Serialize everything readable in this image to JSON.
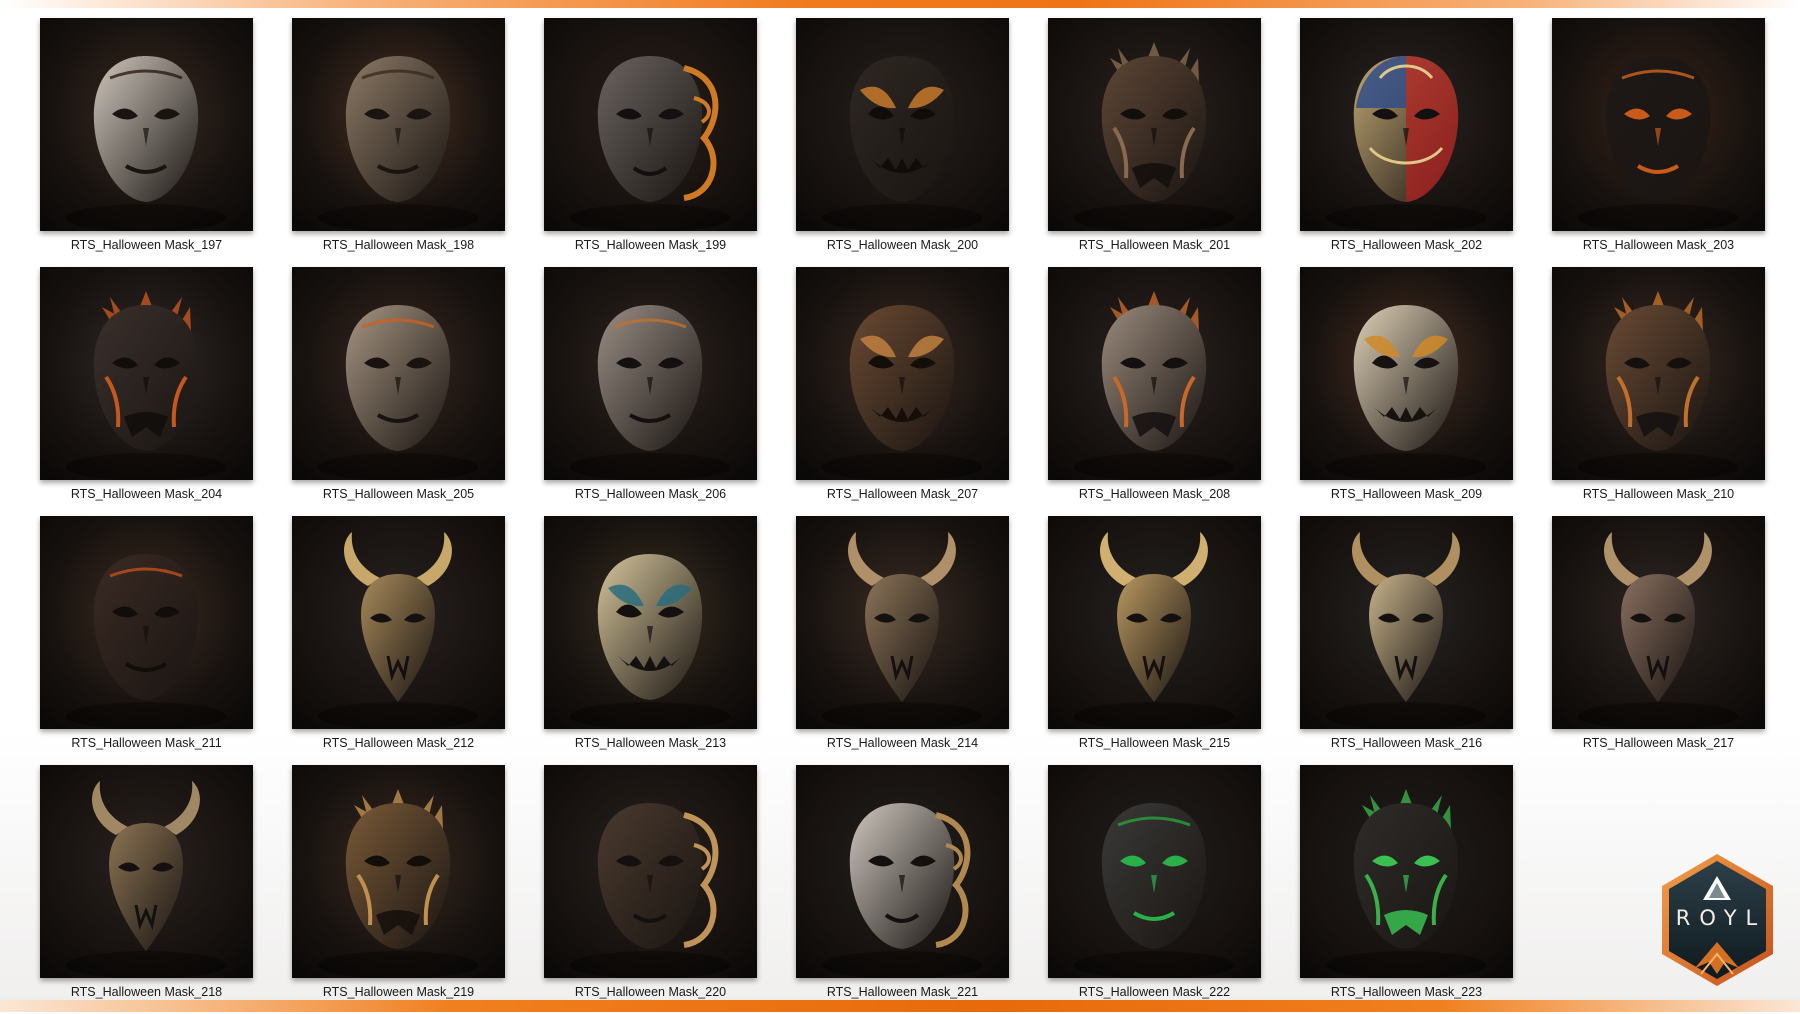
{
  "gallery": {
    "items": [
      {
        "label": "RTS_Halloween Mask_197",
        "bg": "#3a2a22",
        "mask": "#cfc7bd",
        "accent": "#2a1c14",
        "style": "face",
        "eyes": "#1a1410"
      },
      {
        "label": "RTS_Halloween Mask_198",
        "bg": "#4a3222",
        "mask": "#8c7a66",
        "accent": "#3a2b20",
        "style": "face",
        "eyes": "#1a1410"
      },
      {
        "label": "RTS_Halloween Mask_199",
        "bg": "#2a1e1a",
        "mask": "#6b6460",
        "accent": "#d07a24",
        "style": "swirl",
        "eyes": "#151010"
      },
      {
        "label": "RTS_Halloween Mask_200",
        "bg": "#24201e",
        "mask": "#2e2722",
        "accent": "#c87a2c",
        "style": "jack",
        "eyes": "#100c0a"
      },
      {
        "label": "RTS_Halloween Mask_201",
        "bg": "#2a2220",
        "mask": "#5e4636",
        "accent": "#8a6a4e",
        "style": "demon",
        "eyes": "#120e0c"
      },
      {
        "label": "RTS_Halloween Mask_202",
        "bg": "#2a2624",
        "mask": "#c2a874",
        "accent": "#b02222",
        "style": "venetian",
        "eyes": "#121010"
      },
      {
        "label": "RTS_Halloween Mask_203",
        "bg": "#3a2418",
        "mask": "#1e1816",
        "accent": "#d0651c",
        "style": "face",
        "eyes": "#c85a1a"
      },
      {
        "label": "RTS_Halloween Mask_204",
        "bg": "#302a28",
        "mask": "#3a302c",
        "accent": "#c4581e",
        "style": "demon",
        "eyes": "#110d0b"
      },
      {
        "label": "RTS_Halloween Mask_205",
        "bg": "#3a2820",
        "mask": "#a69582",
        "accent": "#d06020",
        "style": "face",
        "eyes": "#181210"
      },
      {
        "label": "RTS_Halloween Mask_206",
        "bg": "#2e2420",
        "mask": "#9a8f86",
        "accent": "#c07030",
        "style": "face",
        "eyes": "#151010"
      },
      {
        "label": "RTS_Halloween Mask_207",
        "bg": "#3a2a22",
        "mask": "#6a4a32",
        "accent": "#c08040",
        "style": "jack",
        "eyes": "#140e0a"
      },
      {
        "label": "RTS_Halloween Mask_208",
        "bg": "#2a2422",
        "mask": "#9a8a7c",
        "accent": "#c8682a",
        "style": "demon",
        "eyes": "#141010"
      },
      {
        "label": "RTS_Halloween Mask_209",
        "bg": "#4a3022",
        "mask": "#e0d2b8",
        "accent": "#d08a28",
        "style": "jack",
        "eyes": "#161210"
      },
      {
        "label": "RTS_Halloween Mask_210",
        "bg": "#3a2a22",
        "mask": "#6a4a34",
        "accent": "#c0702a",
        "style": "demon",
        "eyes": "#141010"
      },
      {
        "label": "RTS_Halloween Mask_211",
        "bg": "#3e2c22",
        "mask": "#3a2a24",
        "accent": "#c0501c",
        "style": "face",
        "eyes": "#110d0b"
      },
      {
        "label": "RTS_Halloween Mask_212",
        "bg": "#262220",
        "mask": "#a88a5a",
        "accent": "#c8a868",
        "style": "horns",
        "eyes": "#141010"
      },
      {
        "label": "RTS_Halloween Mask_213",
        "bg": "#3a3022",
        "mask": "#d6c69c",
        "accent": "#2a6c7c",
        "style": "jack",
        "eyes": "#151010"
      },
      {
        "label": "RTS_Halloween Mask_214",
        "bg": "#3a2c24",
        "mask": "#8c7458",
        "accent": "#b09068",
        "style": "horns",
        "eyes": "#141010"
      },
      {
        "label": "RTS_Halloween Mask_215",
        "bg": "#242222",
        "mask": "#b89860",
        "accent": "#d0b070",
        "style": "horns",
        "eyes": "#141010"
      },
      {
        "label": "RTS_Halloween Mask_216",
        "bg": "#262424",
        "mask": "#c8b48c",
        "accent": "#b09060",
        "style": "horns",
        "eyes": "#141010"
      },
      {
        "label": "RTS_Halloween Mask_217",
        "bg": "#2e2624",
        "mask": "#8a7060",
        "accent": "#b0926a",
        "style": "horns",
        "eyes": "#141010"
      },
      {
        "label": "RTS_Halloween Mask_218",
        "bg": "#2a2220",
        "mask": "#8c7454",
        "accent": "#a08864",
        "style": "horns",
        "eyes": "#141010"
      },
      {
        "label": "RTS_Halloween Mask_219",
        "bg": "#3a2a20",
        "mask": "#7a5a38",
        "accent": "#c09050",
        "style": "demon",
        "eyes": "#140e0a"
      },
      {
        "label": "RTS_Halloween Mask_220",
        "bg": "#2a2220",
        "mask": "#4a3a2e",
        "accent": "#c09458",
        "style": "swirl",
        "eyes": "#141010"
      },
      {
        "label": "RTS_Halloween Mask_221",
        "bg": "#222020",
        "mask": "#cfc8c0",
        "accent": "#b08850",
        "style": "swirl",
        "eyes": "#141010"
      },
      {
        "label": "RTS_Halloween Mask_222",
        "bg": "#1e1e1e",
        "mask": "#3a3a38",
        "accent": "#2aa03a",
        "style": "face",
        "eyes": "#2ab048"
      },
      {
        "label": "RTS_Halloween Mask_223",
        "bg": "#1e1c1c",
        "mask": "#2e2c2a",
        "accent": "#3ab04a",
        "style": "demon",
        "eyes": "#3ac050"
      }
    ]
  },
  "logo": {
    "text": "ROYL",
    "colors": {
      "outer": "#e87a22",
      "inner": "#1c2a30",
      "peak": "#ffffff"
    }
  },
  "colors": {
    "accent": "#ef7416"
  }
}
